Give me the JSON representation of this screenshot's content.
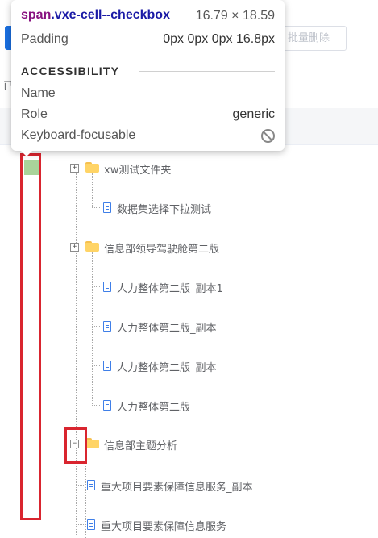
{
  "toolbar": {
    "batch_delete_label": "批量删除"
  },
  "page": {
    "partial_label": "已"
  },
  "tree": {
    "rows": [
      {
        "label": "xw测试文件夹",
        "type": "folder",
        "expander": "+"
      },
      {
        "label": "数据集选择下拉测试",
        "type": "file"
      },
      {
        "label": "信息部领导驾驶舱第二版",
        "type": "folder",
        "expander": "+"
      },
      {
        "label": "人力整体第二版_副本1",
        "type": "file"
      },
      {
        "label": "人力整体第二版_副本",
        "type": "file"
      },
      {
        "label": "人力整体第二版_副本",
        "type": "file"
      },
      {
        "label": "人力整体第二版",
        "type": "file"
      },
      {
        "label": "信息部主题分析",
        "type": "folder",
        "expander": "−"
      },
      {
        "label": "重大项目要素保障信息服务_副本",
        "type": "file"
      },
      {
        "label": "重大项目要素保障信息服务",
        "type": "file"
      }
    ]
  },
  "tooltip": {
    "selector_tag": "span",
    "selector_class": ".vxe-cell--checkbox",
    "size": "16.79 × 18.59",
    "padding_label": "Padding",
    "padding_value": "0px 0px 0px 16.8px",
    "section_title": "ACCESSIBILITY",
    "name_label": "Name",
    "name_value": "",
    "role_label": "Role",
    "role_value": "generic",
    "focusable_label": "Keyboard-focusable"
  },
  "colors": {
    "highlight_red": "#d9252f",
    "checkbox_green": "#a9d39a",
    "folder_yellow": "#ffd466",
    "file_blue": "#3f7fe8",
    "primary_blue": "#1a6fe0"
  }
}
